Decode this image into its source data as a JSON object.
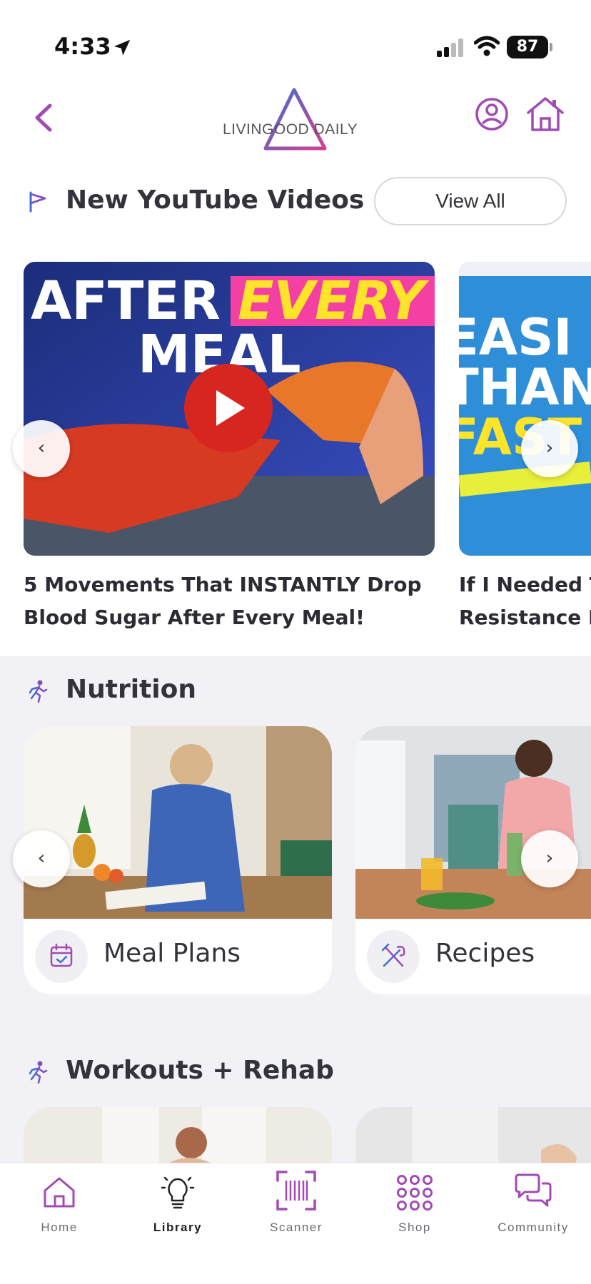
{
  "status_bar": {
    "time": "4:33",
    "battery": "87"
  },
  "header": {
    "logo_text": "LIVINGOOD DAILY"
  },
  "youtube": {
    "title": "New YouTube Videos",
    "view_all": "View All",
    "videos": [
      {
        "title_line1": "5 Movements That INSTANTLY Drop",
        "title_line2": "Blood Sugar After Every Meal!",
        "thumb_text1": "AFTER",
        "thumb_text2": "EVERY",
        "thumb_text3": "MEAL"
      },
      {
        "title_line1": "If I Needed T",
        "title_line2": "Resistance F",
        "thumb_text1": "EASI",
        "thumb_text2": "THAN",
        "thumb_text3": "FAST"
      }
    ]
  },
  "nutrition": {
    "title": "Nutrition",
    "items": [
      {
        "label": "Meal Plans"
      },
      {
        "label": "Recipes"
      }
    ]
  },
  "workouts": {
    "title": "Workouts + Rehab"
  },
  "carousel": {
    "prev": "‹",
    "next": "›"
  },
  "bottom_nav": {
    "items": [
      {
        "label": "Home"
      },
      {
        "label": "Library"
      },
      {
        "label": "Scanner"
      },
      {
        "label": "Shop"
      },
      {
        "label": "Community"
      }
    ]
  },
  "colors": {
    "accent": "#a24bb3",
    "brand_blue": "#3f6fd1",
    "brand_pink": "#d43f8d"
  }
}
